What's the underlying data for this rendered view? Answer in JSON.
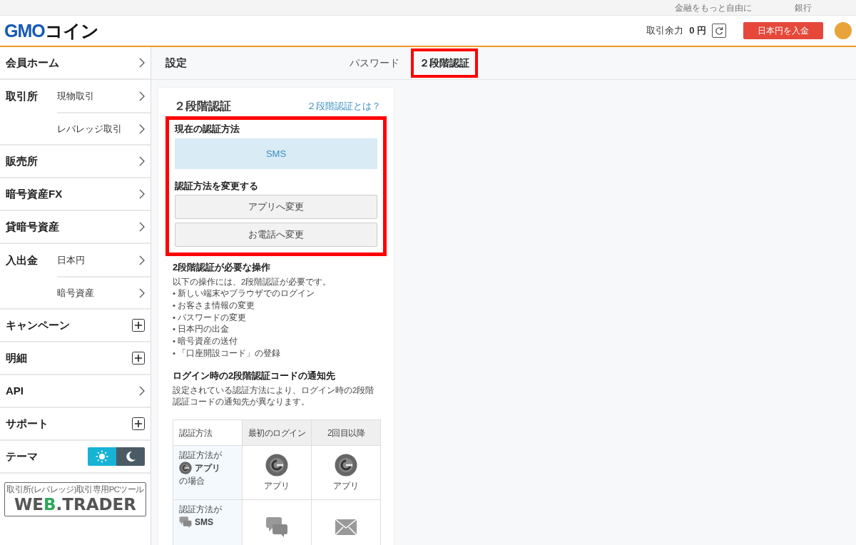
{
  "top_links": [
    "金融をもっと自由に",
    "銀行"
  ],
  "header": {
    "logo": [
      {
        "text": "GMO",
        "kind": "brand"
      },
      {
        "text": "コイン",
        "kind": "plain"
      }
    ],
    "balance_label": "取引余力",
    "balance_value": "0 円",
    "deposit_button": "日本円を入金"
  },
  "sidebar": {
    "items": [
      {
        "label": "会員ホーム",
        "kind": "link"
      },
      {
        "label": "取引所",
        "kind": "group",
        "children": [
          {
            "label": "現物取引"
          },
          {
            "label": "レバレッジ取引"
          }
        ]
      },
      {
        "label": "販売所",
        "kind": "link"
      },
      {
        "label": "暗号資産FX",
        "kind": "link"
      },
      {
        "label": "貸暗号資産",
        "kind": "link"
      },
      {
        "label": "入出金",
        "kind": "group",
        "children": [
          {
            "label": "日本円"
          },
          {
            "label": "暗号資産"
          }
        ]
      },
      {
        "label": "キャンペーン",
        "kind": "expand",
        "expanded": false
      },
      {
        "label": "明細",
        "kind": "expand",
        "expanded": false
      },
      {
        "label": "API",
        "kind": "link"
      },
      {
        "label": "サポート",
        "kind": "expand",
        "expanded": false
      }
    ],
    "theme": {
      "label": "テーマ",
      "options": [
        {
          "kind": "light",
          "selected": true
        },
        {
          "kind": "dark",
          "selected": false
        }
      ]
    },
    "banner": {
      "caption": "取引所(レバレッジ)取引専用PCツール",
      "logo": [
        {
          "text": "WE",
          "accent": false
        },
        {
          "text": "B",
          "accent": true
        },
        {
          "text": ".TRADER",
          "accent": false
        }
      ]
    }
  },
  "page": {
    "title": "設定",
    "tabs": [
      {
        "label": "パスワード",
        "selected": false,
        "highlighted": false
      },
      {
        "label": "２段階認証",
        "selected": true,
        "highlighted": true
      }
    ]
  },
  "card": {
    "title": "２段階認証",
    "help_link": "２段階認証とは？",
    "highlighted": true,
    "current_label": "現在の認証方法",
    "current_method": "SMS",
    "change_label": "認証方法を変更する",
    "change_buttons": [
      "アプリへ変更",
      "お電話へ変更"
    ],
    "ops_heading": "2段階認証が必要な操作",
    "ops_intro": "以下の操作には、2段階認証が必要です。",
    "ops": [
      "• 新しい端末やブラウザでのログイン",
      "• お客さま情報の変更",
      "• パスワードの変更",
      "• 日本円の出金",
      "• 暗号資産の送付",
      "• 「口座開設コード」の登録"
    ],
    "notify_heading": "ログイン時の2段階認証コードの通知先",
    "notify_text": "設定されている認証方法により、ログイン時の2段階認証コードの通知先が異なります。",
    "table": {
      "columns": [
        "認証方法",
        "最初のログイン",
        "2回目以降"
      ],
      "rows": [
        {
          "cells": [
            {
              "kind": "app",
              "prefix": "認証方法が",
              "method": "アプリ",
              "suffix": "の場合"
            },
            {
              "kind": "app",
              "label": "アプリ"
            },
            {
              "kind": "app",
              "label": "アプリ"
            }
          ]
        },
        {
          "cells": [
            {
              "kind": "sms",
              "prefix": "認証方法が",
              "method": "SMS"
            },
            {
              "kind": "chat"
            },
            {
              "kind": "mail"
            }
          ]
        }
      ]
    }
  }
}
